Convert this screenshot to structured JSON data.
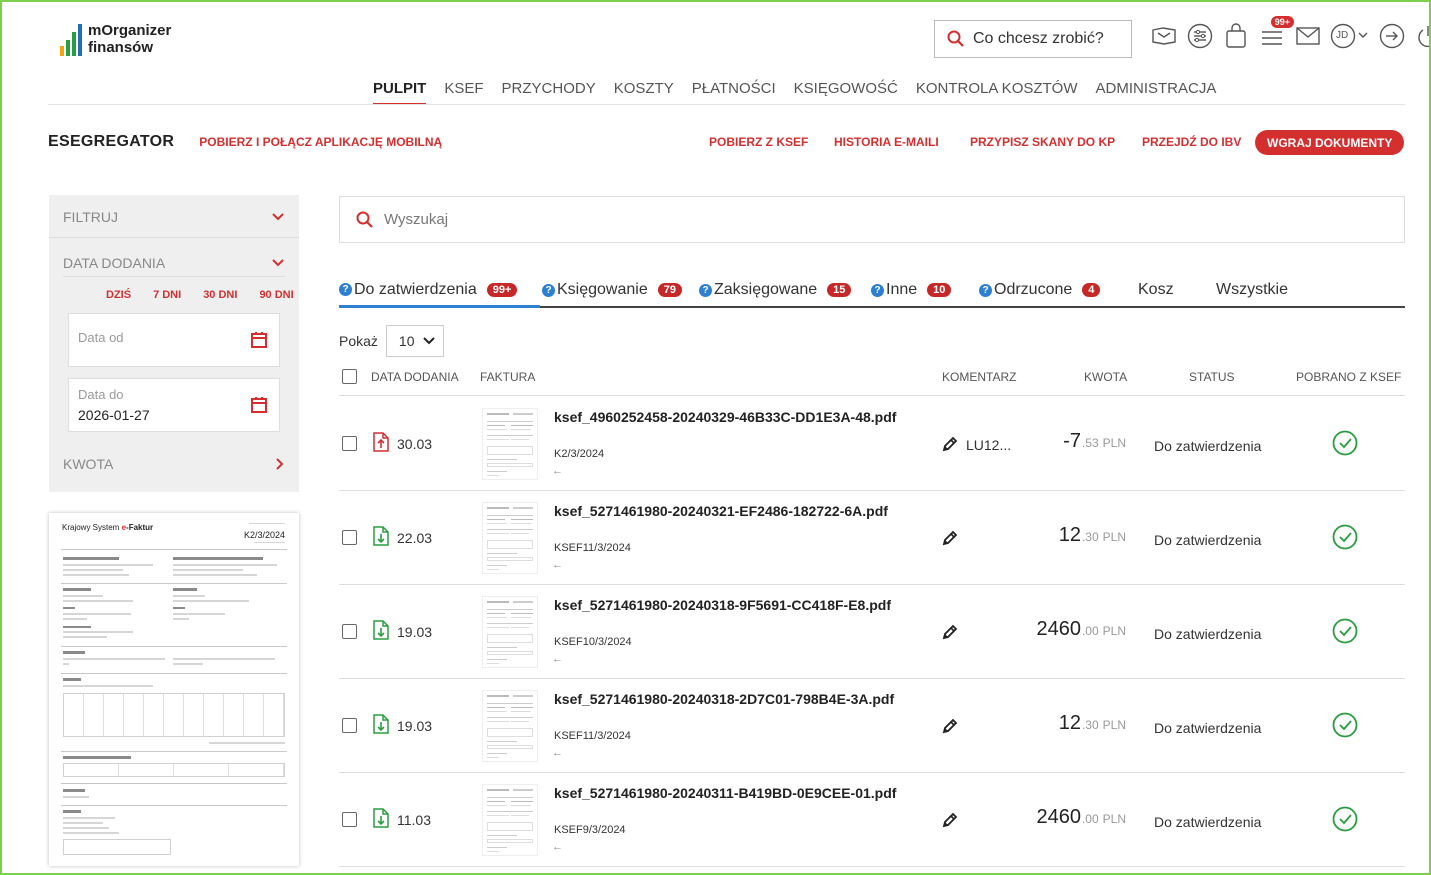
{
  "app": {
    "logo_line1": "mOrganizer",
    "logo_line2": "finansów",
    "logo_bar_colors": [
      "#f2a60d",
      "#2a9d3e",
      "#2a9d3e",
      "#1f6fb2"
    ],
    "accent_color": "#d32f2f"
  },
  "header": {
    "search_placeholder": "Co chcesz zrobić?",
    "notification_badge": "99+",
    "avatar_initials": "JD",
    "icons": [
      "support-icon",
      "settings-sliders-icon",
      "cart-icon",
      "notifications-list-icon",
      "mail-icon",
      "user-avatar-icon",
      "logout-icon",
      "power-icon"
    ]
  },
  "nav": {
    "items": [
      "PULPIT",
      "KSEF",
      "PRZYCHODY",
      "KOSZTY",
      "PŁATNOŚCI",
      "KSIĘGOWOŚĆ",
      "KONTROLA KOSZTÓW",
      "ADMINISTRACJA"
    ],
    "active": "PULPIT"
  },
  "subbar": {
    "title": "ESEGREGATOR",
    "mobile_link": "POBIERZ I POŁĄCZ APLIKACJĘ MOBILNĄ",
    "links": [
      "POBIERZ Z KSEF",
      "HISTORIA E-MAILI",
      "PRZYPISZ SKANY DO KP",
      "PRZEJDŹ DO IBV"
    ],
    "upload_button": "WGRAJ DOKUMENTY"
  },
  "sidebar": {
    "filter_label": "FILTRUJ",
    "date_added_label": "DATA DODANIA",
    "quick_ranges": [
      "DZIŚ",
      "7 DNI",
      "30 DNI",
      "90 DNI"
    ],
    "date_from_label": "Data od",
    "date_to_label": "Data do",
    "date_to_value": "2026-01-27",
    "amount_label": "KWOTA"
  },
  "preview": {
    "title_prefix": "Krajowy System ",
    "title_e": "e",
    "title_suffix": "-Faktur",
    "invoice_number": "K2/3/2024"
  },
  "main": {
    "search_placeholder": "Wyszukaj",
    "tabs": [
      {
        "label": "Do zatwierdzenia",
        "count": "99+",
        "help": "?"
      },
      {
        "label": "Księgowanie",
        "count": "79",
        "help": "?"
      },
      {
        "label": "Zaksięgowane",
        "count": "15",
        "help": "?"
      },
      {
        "label": "Inne",
        "count": "10",
        "help": "?"
      },
      {
        "label": "Odrzucone",
        "count": "4",
        "help": "?"
      },
      {
        "label": "Kosz"
      },
      {
        "label": "Wszystkie"
      }
    ],
    "show_label": "Pokaż",
    "page_size": "10",
    "columns": [
      "DATA DODANIA",
      "FAKTURA",
      "KOMENTARZ",
      "KWOTA",
      "STATUS",
      "POBRANO Z KSEF"
    ]
  },
  "rows": [
    {
      "date": "30.03",
      "file": "ksef_4960252458-20240329-46B33C-DD1E3A-48.pdf",
      "number": "K2/3/2024",
      "comment": "LU12...",
      "amount_int": "-7",
      "amount_dec": ".53",
      "currency": "PLN",
      "status": "Do zatwierdzenia",
      "file_icon": "pdf-upload-icon"
    },
    {
      "date": "22.03",
      "file": "ksef_5271461980-20240321-EF2486-182722-6A.pdf",
      "number": "KSEF11/3/2024",
      "comment": "",
      "amount_int": "12",
      "amount_dec": ".30",
      "currency": "PLN",
      "status": "Do zatwierdzenia",
      "file_icon": "pdf-download-icon"
    },
    {
      "date": "19.03",
      "file": "ksef_5271461980-20240318-9F5691-CC418F-E8.pdf",
      "number": "KSEF10/3/2024",
      "comment": "",
      "amount_int": "2460",
      "amount_dec": ".00",
      "currency": "PLN",
      "status": "Do zatwierdzenia",
      "file_icon": "pdf-download-icon"
    },
    {
      "date": "19.03",
      "file": "ksef_5271461980-20240318-2D7C01-798B4E-3A.pdf",
      "number": "KSEF11/3/2024",
      "comment": "",
      "amount_int": "12",
      "amount_dec": ".30",
      "currency": "PLN",
      "status": "Do zatwierdzenia",
      "file_icon": "pdf-download-icon"
    },
    {
      "date": "11.03",
      "file": "ksef_5271461980-20240311-B419BD-0E9CEE-01.pdf",
      "number": "KSEF9/3/2024",
      "comment": "",
      "amount_int": "2460",
      "amount_dec": ".00",
      "currency": "PLN",
      "status": "Do zatwierdzenia",
      "file_icon": "pdf-download-icon"
    }
  ]
}
